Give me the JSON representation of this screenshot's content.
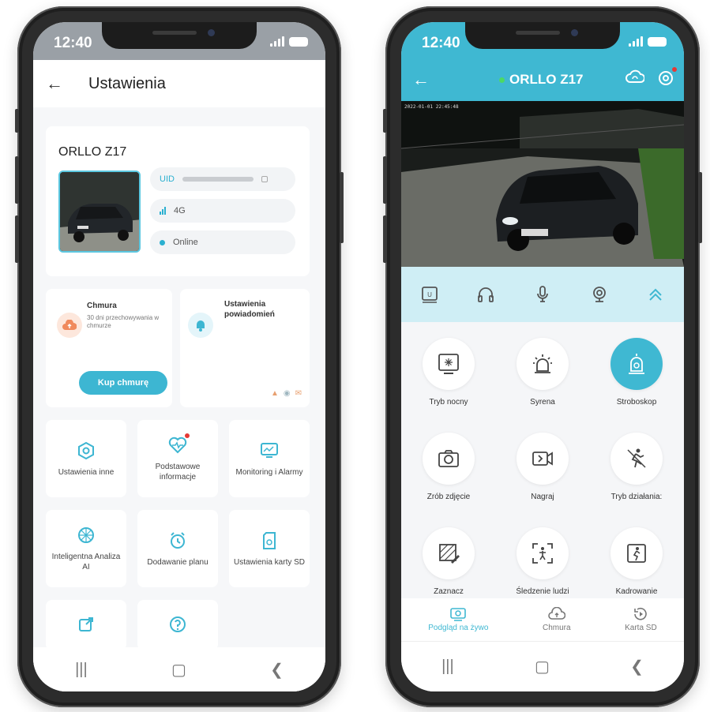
{
  "left_phone": {
    "status": {
      "time": "12:40"
    },
    "header": {
      "title": "Ustawienia"
    },
    "device": {
      "name": "ORLLO Z17",
      "uid_label": "UID",
      "network": "4G",
      "status": "Online"
    },
    "cloud_card": {
      "title": "Chmura",
      "subtitle": "30 dni przechowywania w chmurze",
      "button": "Kup chmurę"
    },
    "notif_card": {
      "title": "Ustawienia powiadomień"
    },
    "grid": [
      {
        "label": "Ustawienia inne",
        "icon": "hexagon-gear-icon"
      },
      {
        "label": "Podstawowe informacje",
        "icon": "heart-pulse-icon"
      },
      {
        "label": "Monitoring i Alarmy",
        "icon": "monitor-alarm-icon"
      },
      {
        "label": "Inteligentna Analiza AI",
        "icon": "ai-brain-icon"
      },
      {
        "label": "Dodawanie planu",
        "icon": "alarm-clock-icon"
      },
      {
        "label": "Ustawienia karty SD",
        "icon": "sd-card-icon"
      },
      {
        "label": "",
        "icon": "share-icon"
      },
      {
        "label": "",
        "icon": "help-icon"
      }
    ]
  },
  "right_phone": {
    "status": {
      "time": "12:40"
    },
    "header": {
      "title": "ORLLO Z17"
    },
    "video": {
      "timestamp": "2022-01-01 22:45:48"
    },
    "controls": [
      "screen-icon",
      "headphones-icon",
      "microphone-icon",
      "camera-icon",
      "chevron-up-icon"
    ],
    "features": [
      {
        "label": "Tryb nocny",
        "icon": "night-mode-icon",
        "active": false
      },
      {
        "label": "Syrena",
        "icon": "siren-icon",
        "active": false
      },
      {
        "label": "Stroboskop",
        "icon": "strobe-icon",
        "active": true
      },
      {
        "label": "Zrób zdjęcie",
        "icon": "photo-camera-icon",
        "active": false
      },
      {
        "label": "Nagraj",
        "icon": "record-video-icon",
        "active": false
      },
      {
        "label": "Tryb działania:",
        "icon": "motion-mode-icon",
        "active": false
      },
      {
        "label": "Zaznacz",
        "icon": "draw-area-icon",
        "active": false
      },
      {
        "label": "Śledzenie ludzi",
        "icon": "human-tracking-icon",
        "active": false
      },
      {
        "label": "Kadrowanie",
        "icon": "framing-icon",
        "active": false
      }
    ],
    "tabs": [
      {
        "label": "Podgląd na żywo",
        "active": true
      },
      {
        "label": "Chmura",
        "active": false
      },
      {
        "label": "Karta SD",
        "active": false
      }
    ]
  },
  "colors": {
    "accent": "#3fb8d2",
    "cloud_orange": "#f08a5d",
    "alert_red": "#e53935"
  }
}
